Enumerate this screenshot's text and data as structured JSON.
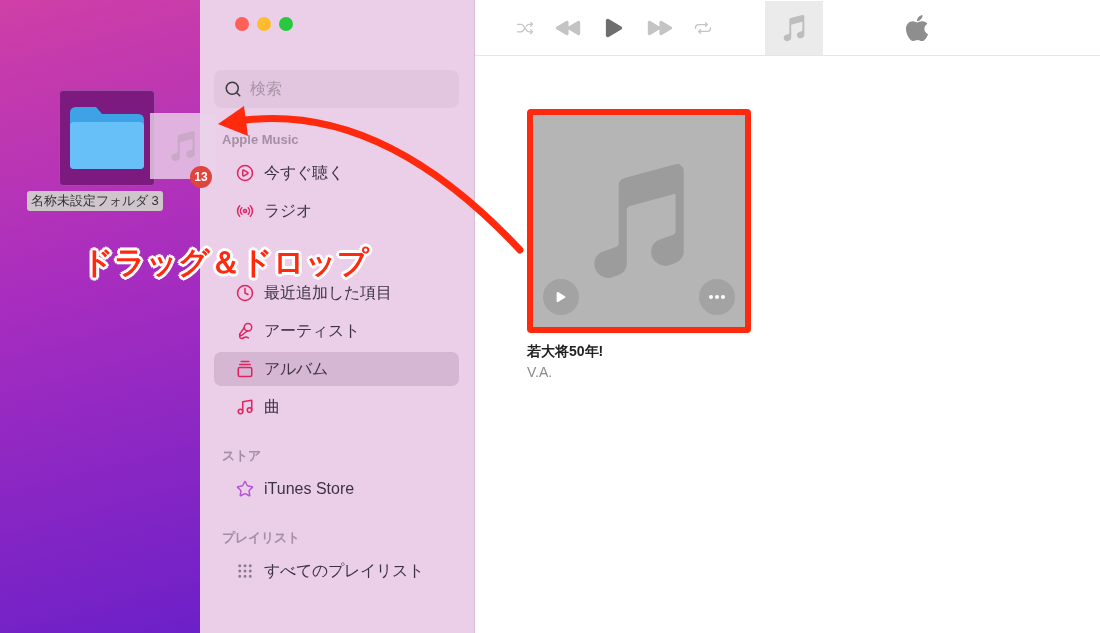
{
  "desktop": {
    "folder": {
      "label": "名称未設定フォルダ 3",
      "selected": true
    },
    "drag": {
      "badge": "13"
    }
  },
  "annotation": {
    "caption": "ドラッグ＆ドロップ"
  },
  "toolbar": {
    "controls": [
      {
        "kind": "shuffle",
        "disabled": true
      },
      {
        "kind": "previous",
        "disabled": true
      },
      {
        "kind": "play",
        "disabled": false
      },
      {
        "kind": "next",
        "disabled": true
      },
      {
        "kind": "repeat",
        "disabled": true
      }
    ]
  },
  "sidebar": {
    "search": {
      "placeholder": "検索"
    },
    "sections": [
      {
        "header": "Apple Music",
        "items": [
          {
            "label": "今すぐ聴く",
            "kind": "listen-now",
            "selected": false
          },
          {
            "label": "ラジオ",
            "kind": "radio",
            "selected": false
          }
        ]
      },
      {
        "items": [
          {
            "label": "最近追加した項目",
            "kind": "recent",
            "selected": false
          },
          {
            "label": "アーティスト",
            "kind": "artist",
            "selected": false
          },
          {
            "label": "アルバム",
            "kind": "album",
            "selected": true
          },
          {
            "label": "曲",
            "kind": "song",
            "selected": false
          }
        ]
      },
      {
        "header": "ストア",
        "items": [
          {
            "label": "iTunes Store",
            "kind": "store",
            "selected": false
          }
        ]
      },
      {
        "header": "プレイリスト",
        "items": [
          {
            "label": "すべてのプレイリスト",
            "kind": "playlists",
            "selected": false
          }
        ]
      }
    ]
  },
  "albums": [
    {
      "title": "若大将50年!",
      "artist": "V.A."
    }
  ]
}
